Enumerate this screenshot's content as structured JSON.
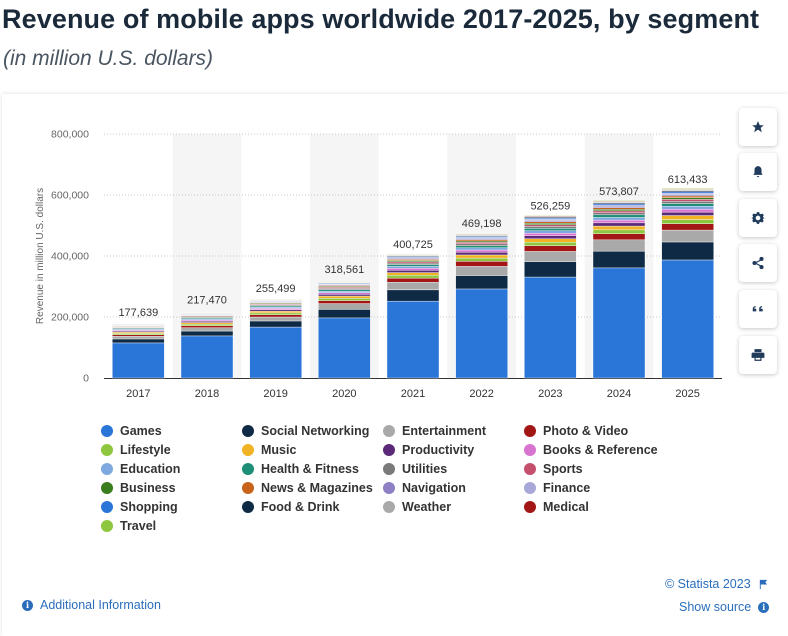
{
  "header": {
    "title": "Revenue of mobile apps worldwide 2017-2025, by segment",
    "subtitle": "(in million U.S. dollars)"
  },
  "toolbar": [
    {
      "name": "favorite",
      "icon": "star-icon"
    },
    {
      "name": "notification",
      "icon": "bell-icon"
    },
    {
      "name": "settings",
      "icon": "gear-icon"
    },
    {
      "name": "share",
      "icon": "share-icon"
    },
    {
      "name": "cite",
      "icon": "quote-icon"
    },
    {
      "name": "print",
      "icon": "printer-icon"
    }
  ],
  "footer": {
    "additional_info": "Additional Information",
    "copyright": "© Statista 2023",
    "show_source": "Show source"
  },
  "chart_data": {
    "type": "bar",
    "stacked": true,
    "title": "Revenue of mobile apps worldwide 2017-2025, by segment",
    "subtitle": "(in million U.S. dollars)",
    "xlabel": "",
    "ylabel": "Revenue in million U.S. dollars",
    "ylim": [
      0,
      800000
    ],
    "yticks": [
      0,
      200000,
      400000,
      600000,
      800000
    ],
    "ytick_labels": [
      "0",
      "200,000",
      "400,000",
      "600,000",
      "800,000"
    ],
    "grid": true,
    "legend_position": "bottom",
    "categories": [
      "2017",
      "2018",
      "2019",
      "2020",
      "2021",
      "2022",
      "2023",
      "2024",
      "2025"
    ],
    "totals": [
      177639,
      217470,
      255499,
      318561,
      400725,
      469198,
      526259,
      573807,
      613433
    ],
    "total_labels": [
      "177,639",
      "217,470",
      "255,499",
      "318,561",
      "400,725",
      "469,198",
      "526,259",
      "573,807",
      "613,433"
    ],
    "series": [
      {
        "name": "Games",
        "color": "#2a75d8",
        "values": [
          115000,
          138000,
          167000,
          197000,
          252000,
          292000,
          331000,
          361000,
          387000
        ]
      },
      {
        "name": "Social Networking",
        "color": "#0f2a44",
        "values": [
          13000,
          16000,
          20000,
          28000,
          37000,
          44000,
          50000,
          55000,
          59000
        ]
      },
      {
        "name": "Entertainment",
        "color": "#a9a9a9",
        "values": [
          9000,
          11000,
          13000,
          19000,
          25000,
          30000,
          34000,
          37000,
          39000
        ]
      },
      {
        "name": "Photo & Video",
        "color": "#a31616",
        "values": [
          5000,
          6500,
          7500,
          10000,
          13500,
          16500,
          18500,
          20000,
          21000
        ]
      },
      {
        "name": "Lifestyle",
        "color": "#8ec63f",
        "values": [
          4200,
          5200,
          6000,
          7500,
          9200,
          10600,
          11700,
          12700,
          13500
        ]
      },
      {
        "name": "Music",
        "color": "#f0b323",
        "values": [
          4200,
          5100,
          5800,
          7200,
          8900,
          10300,
          11400,
          12400,
          13200
        ]
      },
      {
        "name": "Productivity",
        "color": "#5a2a78",
        "values": [
          3500,
          4200,
          4800,
          6000,
          7600,
          8800,
          9800,
          10600,
          11300
        ]
      },
      {
        "name": "Books & Reference",
        "color": "#d874d0",
        "values": [
          3000,
          3600,
          4100,
          5100,
          6400,
          7400,
          8200,
          8900,
          9500
        ]
      },
      {
        "name": "Education",
        "color": "#7fa8e0",
        "values": [
          2900,
          3500,
          4000,
          5000,
          6300,
          7300,
          8100,
          8800,
          9400
        ]
      },
      {
        "name": "Health & Fitness",
        "color": "#1d8f78",
        "values": [
          2800,
          3400,
          3900,
          4900,
          6100,
          7100,
          7900,
          8600,
          9100
        ]
      },
      {
        "name": "Utilities",
        "color": "#7a7a7a",
        "values": [
          2400,
          2900,
          3300,
          4100,
          5100,
          5900,
          6500,
          7100,
          7500
        ]
      },
      {
        "name": "Sports",
        "color": "#c4506e",
        "values": [
          2000,
          2400,
          2700,
          3400,
          4200,
          4900,
          5400,
          5900,
          6200
        ]
      },
      {
        "name": "Business",
        "color": "#3a7d1c",
        "values": [
          1800,
          2200,
          2500,
          3100,
          3900,
          4500,
          5000,
          5400,
          5800
        ]
      },
      {
        "name": "News & Magazines",
        "color": "#c8641a",
        "values": [
          1700,
          2100,
          2400,
          3000,
          3700,
          4300,
          4800,
          5200,
          5500
        ]
      },
      {
        "name": "Navigation",
        "color": "#8f7fc4",
        "values": [
          1500,
          1800,
          2100,
          2600,
          3300,
          3800,
          4200,
          4500,
          4800
        ]
      },
      {
        "name": "Finance",
        "color": "#a8a8d8",
        "values": [
          1400,
          1700,
          1900,
          2400,
          3000,
          3500,
          3900,
          4200,
          4500
        ]
      },
      {
        "name": "Shopping",
        "color": "#2a75d8",
        "values": [
          1300,
          1600,
          1800,
          2200,
          2800,
          3200,
          3600,
          3900,
          4100
        ]
      },
      {
        "name": "Food & Drink",
        "color": "#0f2a44",
        "values": [
          1100,
          1400,
          1600,
          1900,
          2400,
          2800,
          3100,
          3400,
          3600
        ]
      },
      {
        "name": "Weather",
        "color": "#a9a9a9",
        "values": [
          900,
          1100,
          1200,
          1500,
          1900,
          2200,
          2500,
          2700,
          2800
        ]
      },
      {
        "name": "Medical",
        "color": "#a31616",
        "values": [
          700,
          900,
          1000,
          1200,
          1500,
          1800,
          2000,
          2200,
          2300
        ]
      },
      {
        "name": "Travel",
        "color": "#8ec63f",
        "values": [
          539,
          470,
          1399,
          1661,
          1925,
          1998,
          2059,
          2307,
          2333
        ]
      }
    ]
  }
}
